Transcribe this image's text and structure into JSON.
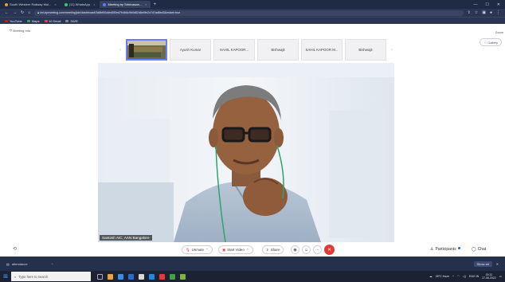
{
  "browser": {
    "tabs": [
      {
        "label": "South Western Railway Mul...",
        "color": "#e0a03a",
        "active": false
      },
      {
        "label": "(11) WhatsApp",
        "color": "#25d366",
        "active": false
      },
      {
        "label": "Meeting by Srinivasan...",
        "color": "#5a7dff",
        "active": true
      }
    ],
    "new_tab_glyph": "+",
    "window_controls": [
      "—",
      "☐",
      "✕"
    ],
    "url": "iml.zipmeeting.com/meeting/join/dashboard/3d8bf00c6ed0f2ed7b4b6c9b0d82d8e6fe2c7d7ad6bd3&nstart=true",
    "bookmarks": [
      {
        "label": "YouTube",
        "color": "#ff0000"
      },
      {
        "label": "Maps",
        "color": "#34a853"
      },
      {
        "label": "M Gmail",
        "color": "#ea4335"
      },
      {
        "label": "SWR",
        "color": "#888888"
      }
    ]
  },
  "meeting": {
    "info_label": "Meeting Info",
    "top_right_label": "Zoom",
    "gallery_label": "⇔ Gallery",
    "thumbnails": [
      "Ayush Kumar",
      "SAHIL KAPOOR...",
      "Bishwajit",
      "SAHIL KAPOOR M...",
      "Bishwajit"
    ],
    "speaker_name": "Santosh AIC, AAN Bangalore"
  },
  "controls": {
    "left_icon_glyph": "⟲",
    "unmute_label": "Unmute",
    "start_video_label": "Start Video",
    "share_label": "Share",
    "participants_label": "Participants",
    "chat_label": "Chat",
    "end_glyph": "✕"
  },
  "downloads": {
    "item_label": "attendance",
    "show_all_label": "Show all",
    "close_glyph": "✕"
  },
  "taskbar": {
    "search_placeholder": "Type here to search",
    "tray_text": "ENG IN",
    "temp": "28°C Haze",
    "time": "15:12",
    "date": "27-06-2022"
  },
  "colors": {
    "end_call": "#e53935",
    "accent": "#2f5bff",
    "browser_chrome": "#1f2a44",
    "taskbar": "#1c2233"
  }
}
